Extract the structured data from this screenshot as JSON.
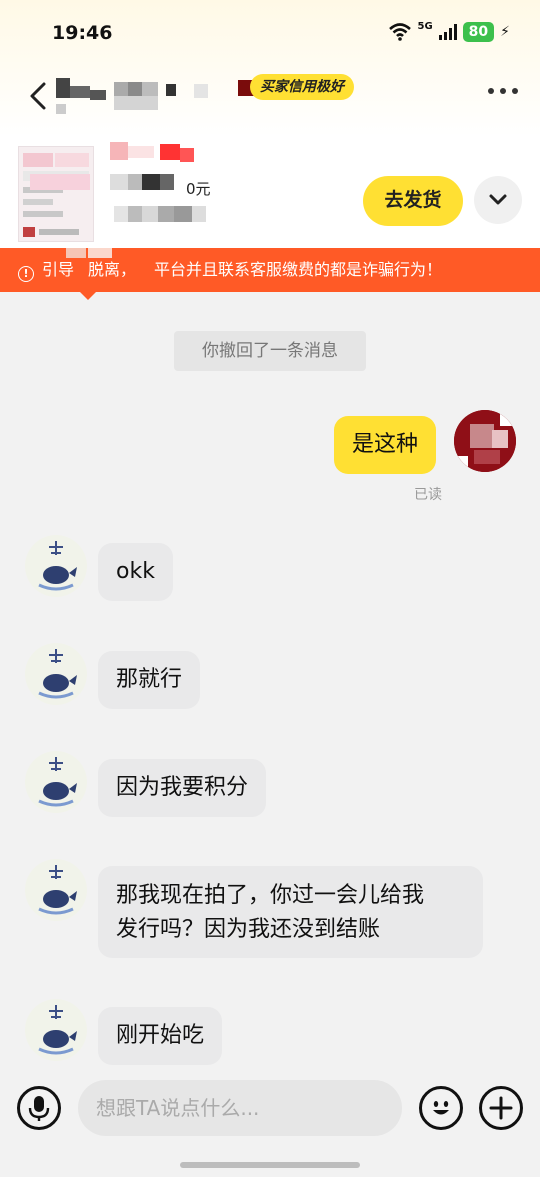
{
  "status": {
    "time": "19:46",
    "network": "5G",
    "battery": "80"
  },
  "header": {
    "badge": "买家信用极好"
  },
  "product": {
    "price": "0元",
    "ship_label": "去发货"
  },
  "warning": {
    "before": "引导",
    "text": "脱离，",
    "text2": "平台并且联系客服缴费的都是诈骗行为！"
  },
  "chat": {
    "system_notice": "你撤回了一条消息",
    "my_message": "是这种",
    "read_label": "已读",
    "messages": [
      {
        "text": "okk"
      },
      {
        "text": "那就行"
      },
      {
        "text": "因为我要积分"
      },
      {
        "text_line1": "那我现在拍了，你过一会儿给我",
        "text_line2": "发行吗？因为我还没到结账"
      },
      {
        "text": "刚开始吃"
      }
    ]
  },
  "input": {
    "placeholder": "想跟TA说点什么..."
  },
  "colors": {
    "accent": "#ffe033",
    "warning": "#ff5a26",
    "battery": "#3cc04c"
  },
  "icons": [
    "back-arrow-icon",
    "more-icon",
    "chevron-down-icon",
    "warning-icon",
    "microphone-icon",
    "emoji-icon",
    "plus-icon",
    "wifi-icon",
    "signal-icon",
    "charging-icon"
  ]
}
